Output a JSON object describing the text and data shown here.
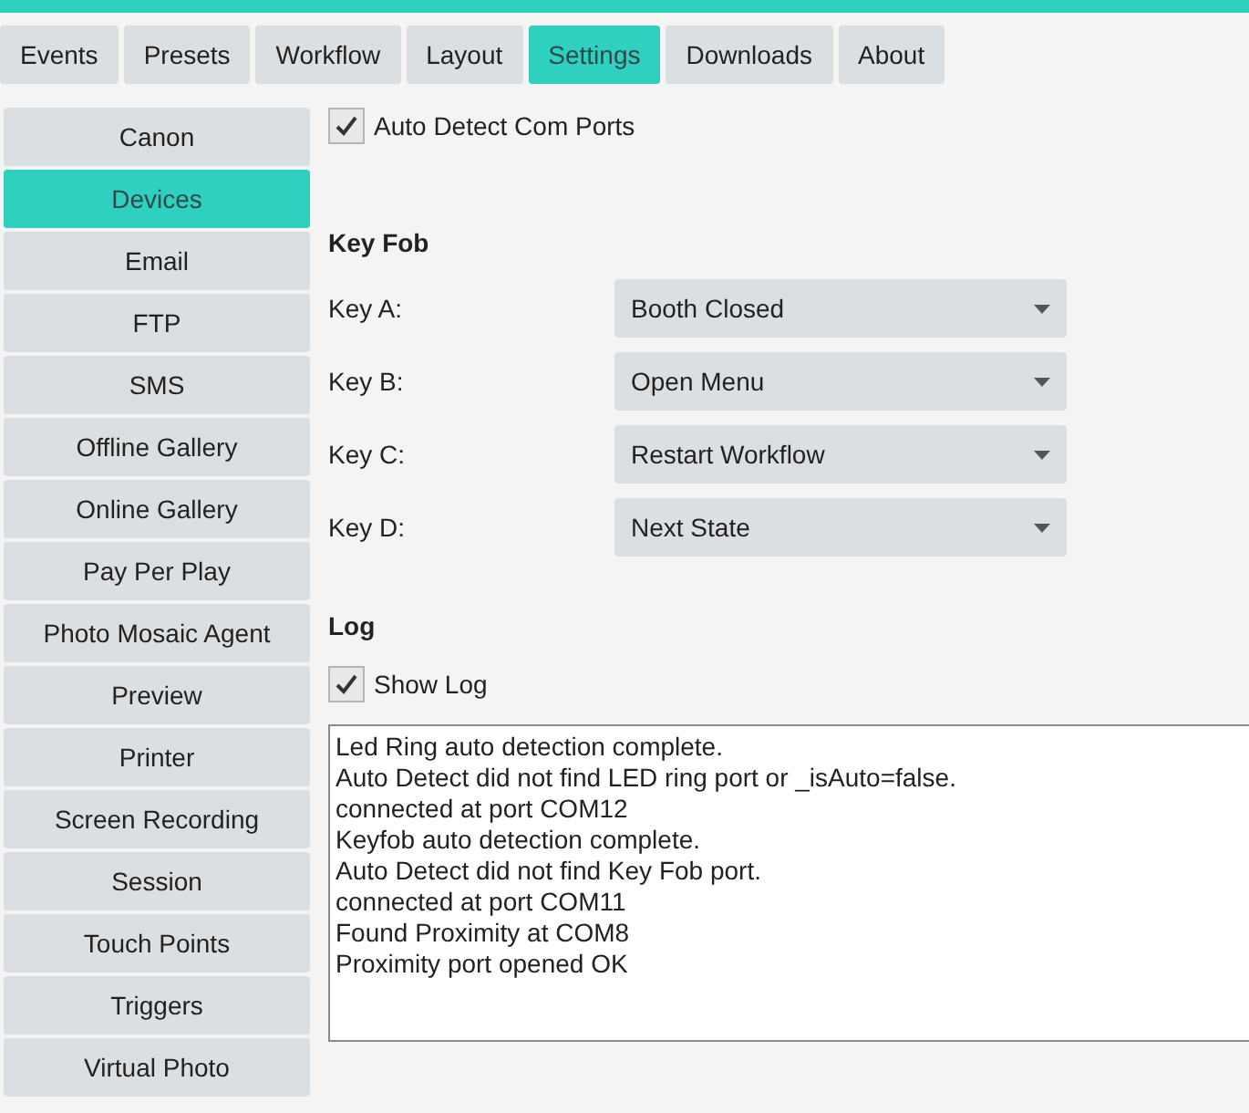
{
  "tabs": [
    {
      "label": "Events",
      "selected": false
    },
    {
      "label": "Presets",
      "selected": false
    },
    {
      "label": "Workflow",
      "selected": false
    },
    {
      "label": "Layout",
      "selected": false
    },
    {
      "label": "Settings",
      "selected": true
    },
    {
      "label": "Downloads",
      "selected": false
    },
    {
      "label": "About",
      "selected": false
    }
  ],
  "sidebar": {
    "items": [
      {
        "label": "Canon",
        "selected": false
      },
      {
        "label": "Devices",
        "selected": true
      },
      {
        "label": "Email",
        "selected": false
      },
      {
        "label": "FTP",
        "selected": false
      },
      {
        "label": "SMS",
        "selected": false
      },
      {
        "label": "Offline Gallery",
        "selected": false
      },
      {
        "label": "Online Gallery",
        "selected": false
      },
      {
        "label": "Pay Per Play",
        "selected": false
      },
      {
        "label": "Photo Mosaic Agent",
        "selected": false
      },
      {
        "label": "Preview",
        "selected": false
      },
      {
        "label": "Printer",
        "selected": false
      },
      {
        "label": "Screen Recording",
        "selected": false
      },
      {
        "label": "Session",
        "selected": false
      },
      {
        "label": "Touch Points",
        "selected": false
      },
      {
        "label": "Triggers",
        "selected": false
      },
      {
        "label": "Virtual Photo",
        "selected": false
      }
    ]
  },
  "auto_detect": {
    "label": "Auto Detect Com Ports",
    "checked": true
  },
  "key_fob": {
    "heading": "Key Fob",
    "keys": [
      {
        "label": "Key A:",
        "value": "Booth Closed"
      },
      {
        "label": "Key B:",
        "value": "Open Menu"
      },
      {
        "label": "Key C:",
        "value": "Restart Workflow"
      },
      {
        "label": "Key D:",
        "value": "Next State"
      }
    ]
  },
  "log": {
    "heading": "Log",
    "show_log": {
      "label": "Show Log",
      "checked": true
    },
    "lines": [
      "Led Ring auto detection complete.",
      "Auto Detect did not find LED ring port or _isAuto=false.",
      "connected at port COM12",
      "Keyfob auto detection complete.",
      "Auto Detect did not find Key Fob port.",
      "connected at port COM11",
      "Found Proximity at COM8",
      "Proximity port opened OK"
    ]
  }
}
